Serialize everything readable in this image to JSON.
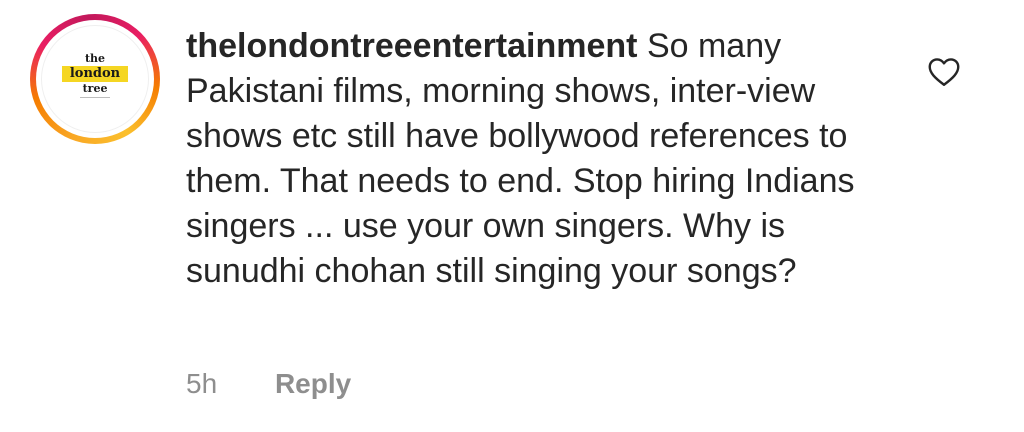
{
  "comment": {
    "avatar": {
      "logo_line1": "the",
      "logo_line2": "london",
      "logo_line3": "tree"
    },
    "username": "thelondontreeentertainment",
    "text": "So many Pakistani films, morning shows, inter-view shows etc still have bollywood references to them. That needs to end. Stop hiring Indians singers ... use your own singers. Why is sunudhi chohan still singing your songs?",
    "time": "5h",
    "reply_label": "Reply"
  },
  "icons": {
    "like": "heart-outline-icon"
  },
  "colors": {
    "ring_start": "#f9a825",
    "ring_mid": "#e91e63",
    "logo_highlight": "#f5d623",
    "text": "#262626",
    "meta": "#8e8e8e"
  }
}
